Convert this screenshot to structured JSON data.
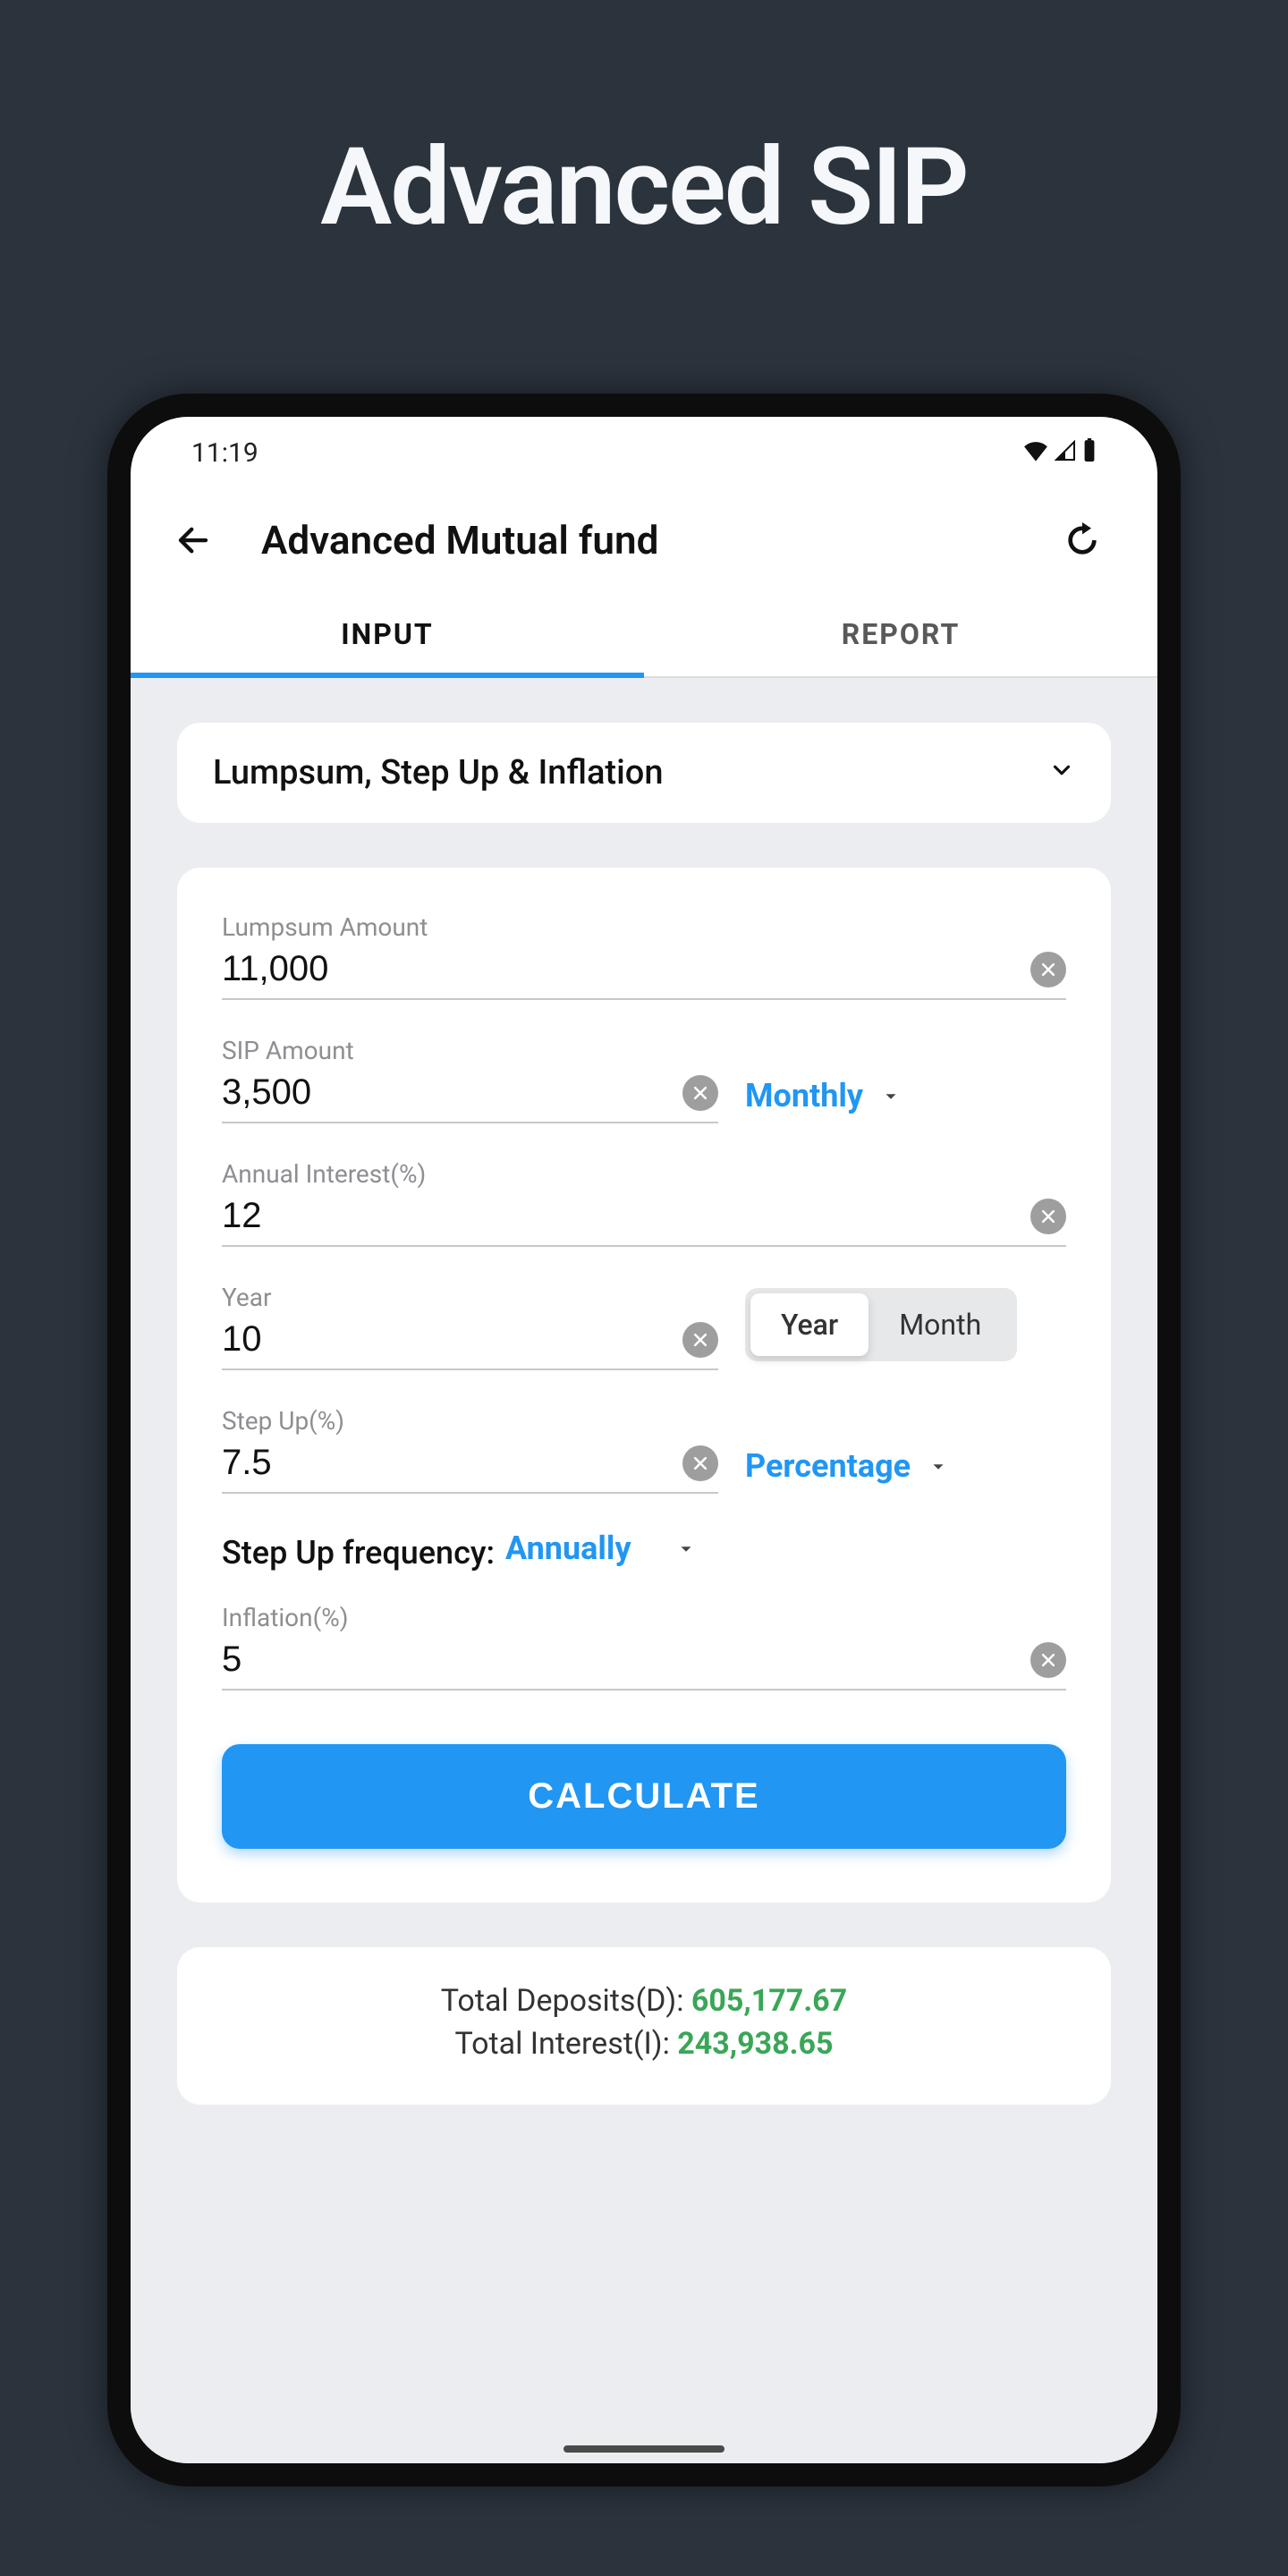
{
  "page": {
    "title": "Advanced SIP"
  },
  "status": {
    "time": "11:19"
  },
  "app_bar": {
    "title": "Advanced Mutual fund"
  },
  "tabs": {
    "input": "INPUT",
    "report": "REPORT",
    "active": "input"
  },
  "selector": {
    "label": "Lumpsum, Step Up & Inflation"
  },
  "fields": {
    "lumpsum": {
      "label": "Lumpsum Amount",
      "value": "11,000"
    },
    "sip": {
      "label": "SIP Amount",
      "value": "3,500",
      "frequency": "Monthly"
    },
    "interest": {
      "label": "Annual Interest(%)",
      "value": "12"
    },
    "tenure": {
      "label": "Year",
      "value": "10",
      "opt_year": "Year",
      "opt_month": "Month"
    },
    "stepup": {
      "label": "Step Up(%)",
      "value": "7.5",
      "mode": "Percentage"
    },
    "stepup_freq": {
      "label": "Step Up frequency:",
      "value": "Annually"
    },
    "inflation": {
      "label": "Inflation(%)",
      "value": "5"
    }
  },
  "buttons": {
    "calculate": "CALCULATE"
  },
  "results": {
    "deposits_label": "Total Deposits(D):",
    "deposits_value": "605,177.67",
    "interest_label": "Total Interest(I):",
    "interest_value": "243,938.65"
  },
  "colors": {
    "accent": "#2196f3",
    "success": "#3aa657"
  }
}
